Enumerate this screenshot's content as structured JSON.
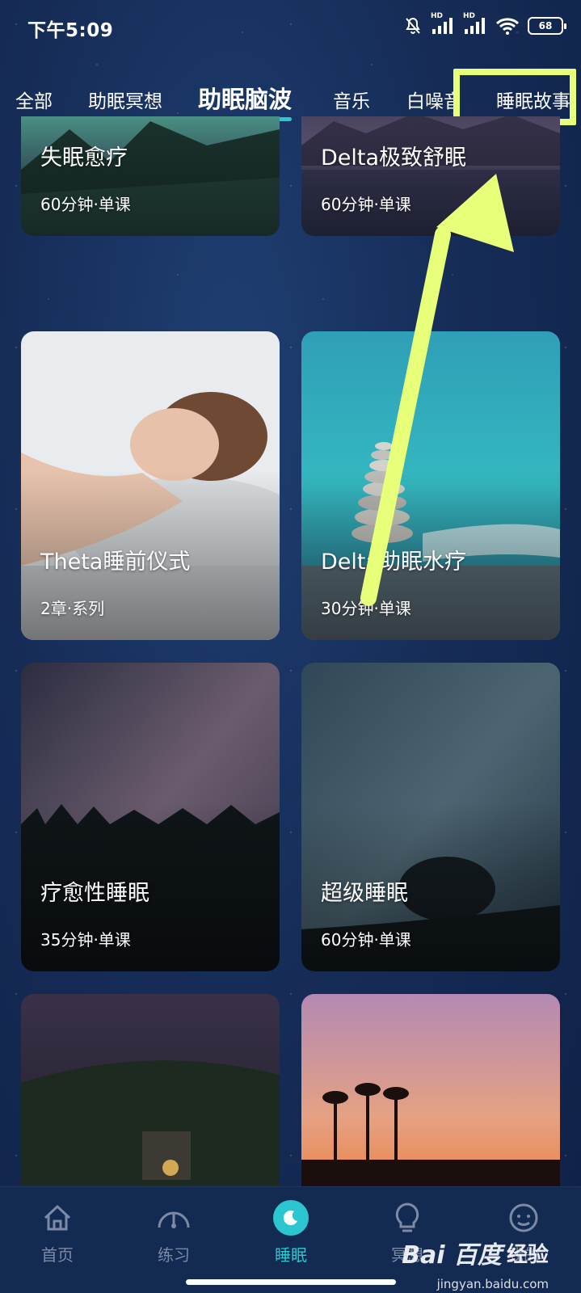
{
  "status_bar": {
    "time": "下午5:09",
    "signal_label_1": "HD",
    "signal_label_2": "HD",
    "battery": "68",
    "icons": [
      "bell-muted-icon",
      "signal-icon",
      "signal-icon",
      "wifi-icon",
      "battery-icon"
    ]
  },
  "tabs": [
    {
      "label": "全部",
      "active": false
    },
    {
      "label": "助眠冥想",
      "active": false
    },
    {
      "label": "助眠脑波",
      "active": true
    },
    {
      "label": "音乐",
      "active": false
    },
    {
      "label": "白噪音",
      "active": false
    },
    {
      "label": "睡眠故事",
      "active": false
    }
  ],
  "cards": [
    {
      "title": "失眠愈疗",
      "meta": "60分钟·单课"
    },
    {
      "title": "Delta极致舒眠",
      "meta": "60分钟·单课"
    },
    {
      "title": "Theta睡前仪式",
      "meta": "2章·系列"
    },
    {
      "title": "Delta助眠水疗",
      "meta": "30分钟·单课"
    },
    {
      "title": "疗愈性睡眠",
      "meta": "35分钟·单课"
    },
    {
      "title": "超级睡眠",
      "meta": "60分钟·单课"
    },
    {
      "title": "",
      "meta": ""
    },
    {
      "title": "",
      "meta": ""
    }
  ],
  "bottom_nav": [
    {
      "label": "首页",
      "icon": "home-icon",
      "active": false
    },
    {
      "label": "练习",
      "icon": "gauge-icon",
      "active": false
    },
    {
      "label": "睡眠",
      "icon": "moon-icon",
      "active": true
    },
    {
      "label": "冥想",
      "icon": "lightbulb-icon",
      "active": false
    },
    {
      "label": "我的",
      "icon": "profile-icon",
      "active": false
    }
  ],
  "watermark": {
    "logo": "Bai 百度",
    "text": "经验",
    "url": "jingyan.baidu.com"
  },
  "colors": {
    "accent": "#2cc6d0",
    "highlight": "#e8ff7a",
    "background": "#162d58"
  }
}
